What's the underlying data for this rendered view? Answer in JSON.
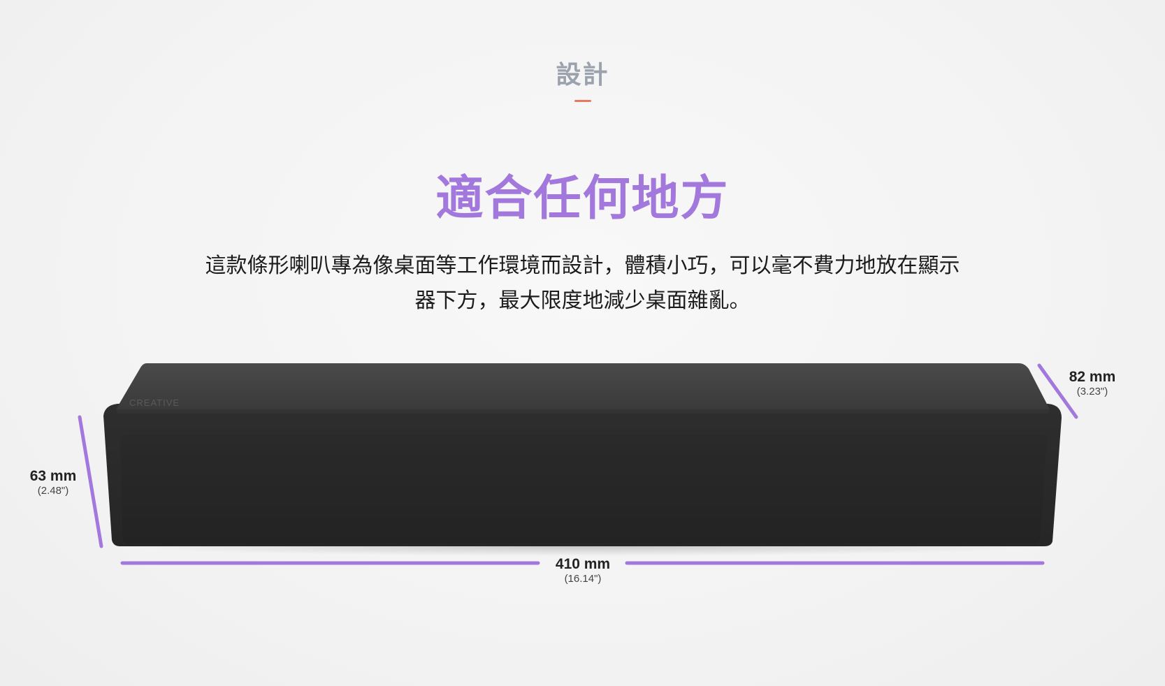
{
  "section": {
    "eyebrow": "設計",
    "headline": "適合任何地方",
    "description_line1": "這款條形喇叭專為像桌面等工作環境而設計，體積小巧，可以毫不費力地放在顯示",
    "description_line2": "器下方，最大限度地減少桌面雜亂。"
  },
  "product": {
    "brand_logo": "CREATIVE",
    "dimensions": {
      "height": {
        "metric": "63 mm",
        "imperial": "(2.48\")"
      },
      "depth": {
        "metric": "82 mm",
        "imperial": "(3.23\")"
      },
      "width": {
        "metric": "410 mm",
        "imperial": "(16.14\")"
      }
    }
  },
  "colors": {
    "accent_purple": "#a378dc",
    "eyebrow_gray": "#9aa2ae",
    "underline_orange": "#e8795e",
    "speaker_body": "#2b2b2b"
  }
}
